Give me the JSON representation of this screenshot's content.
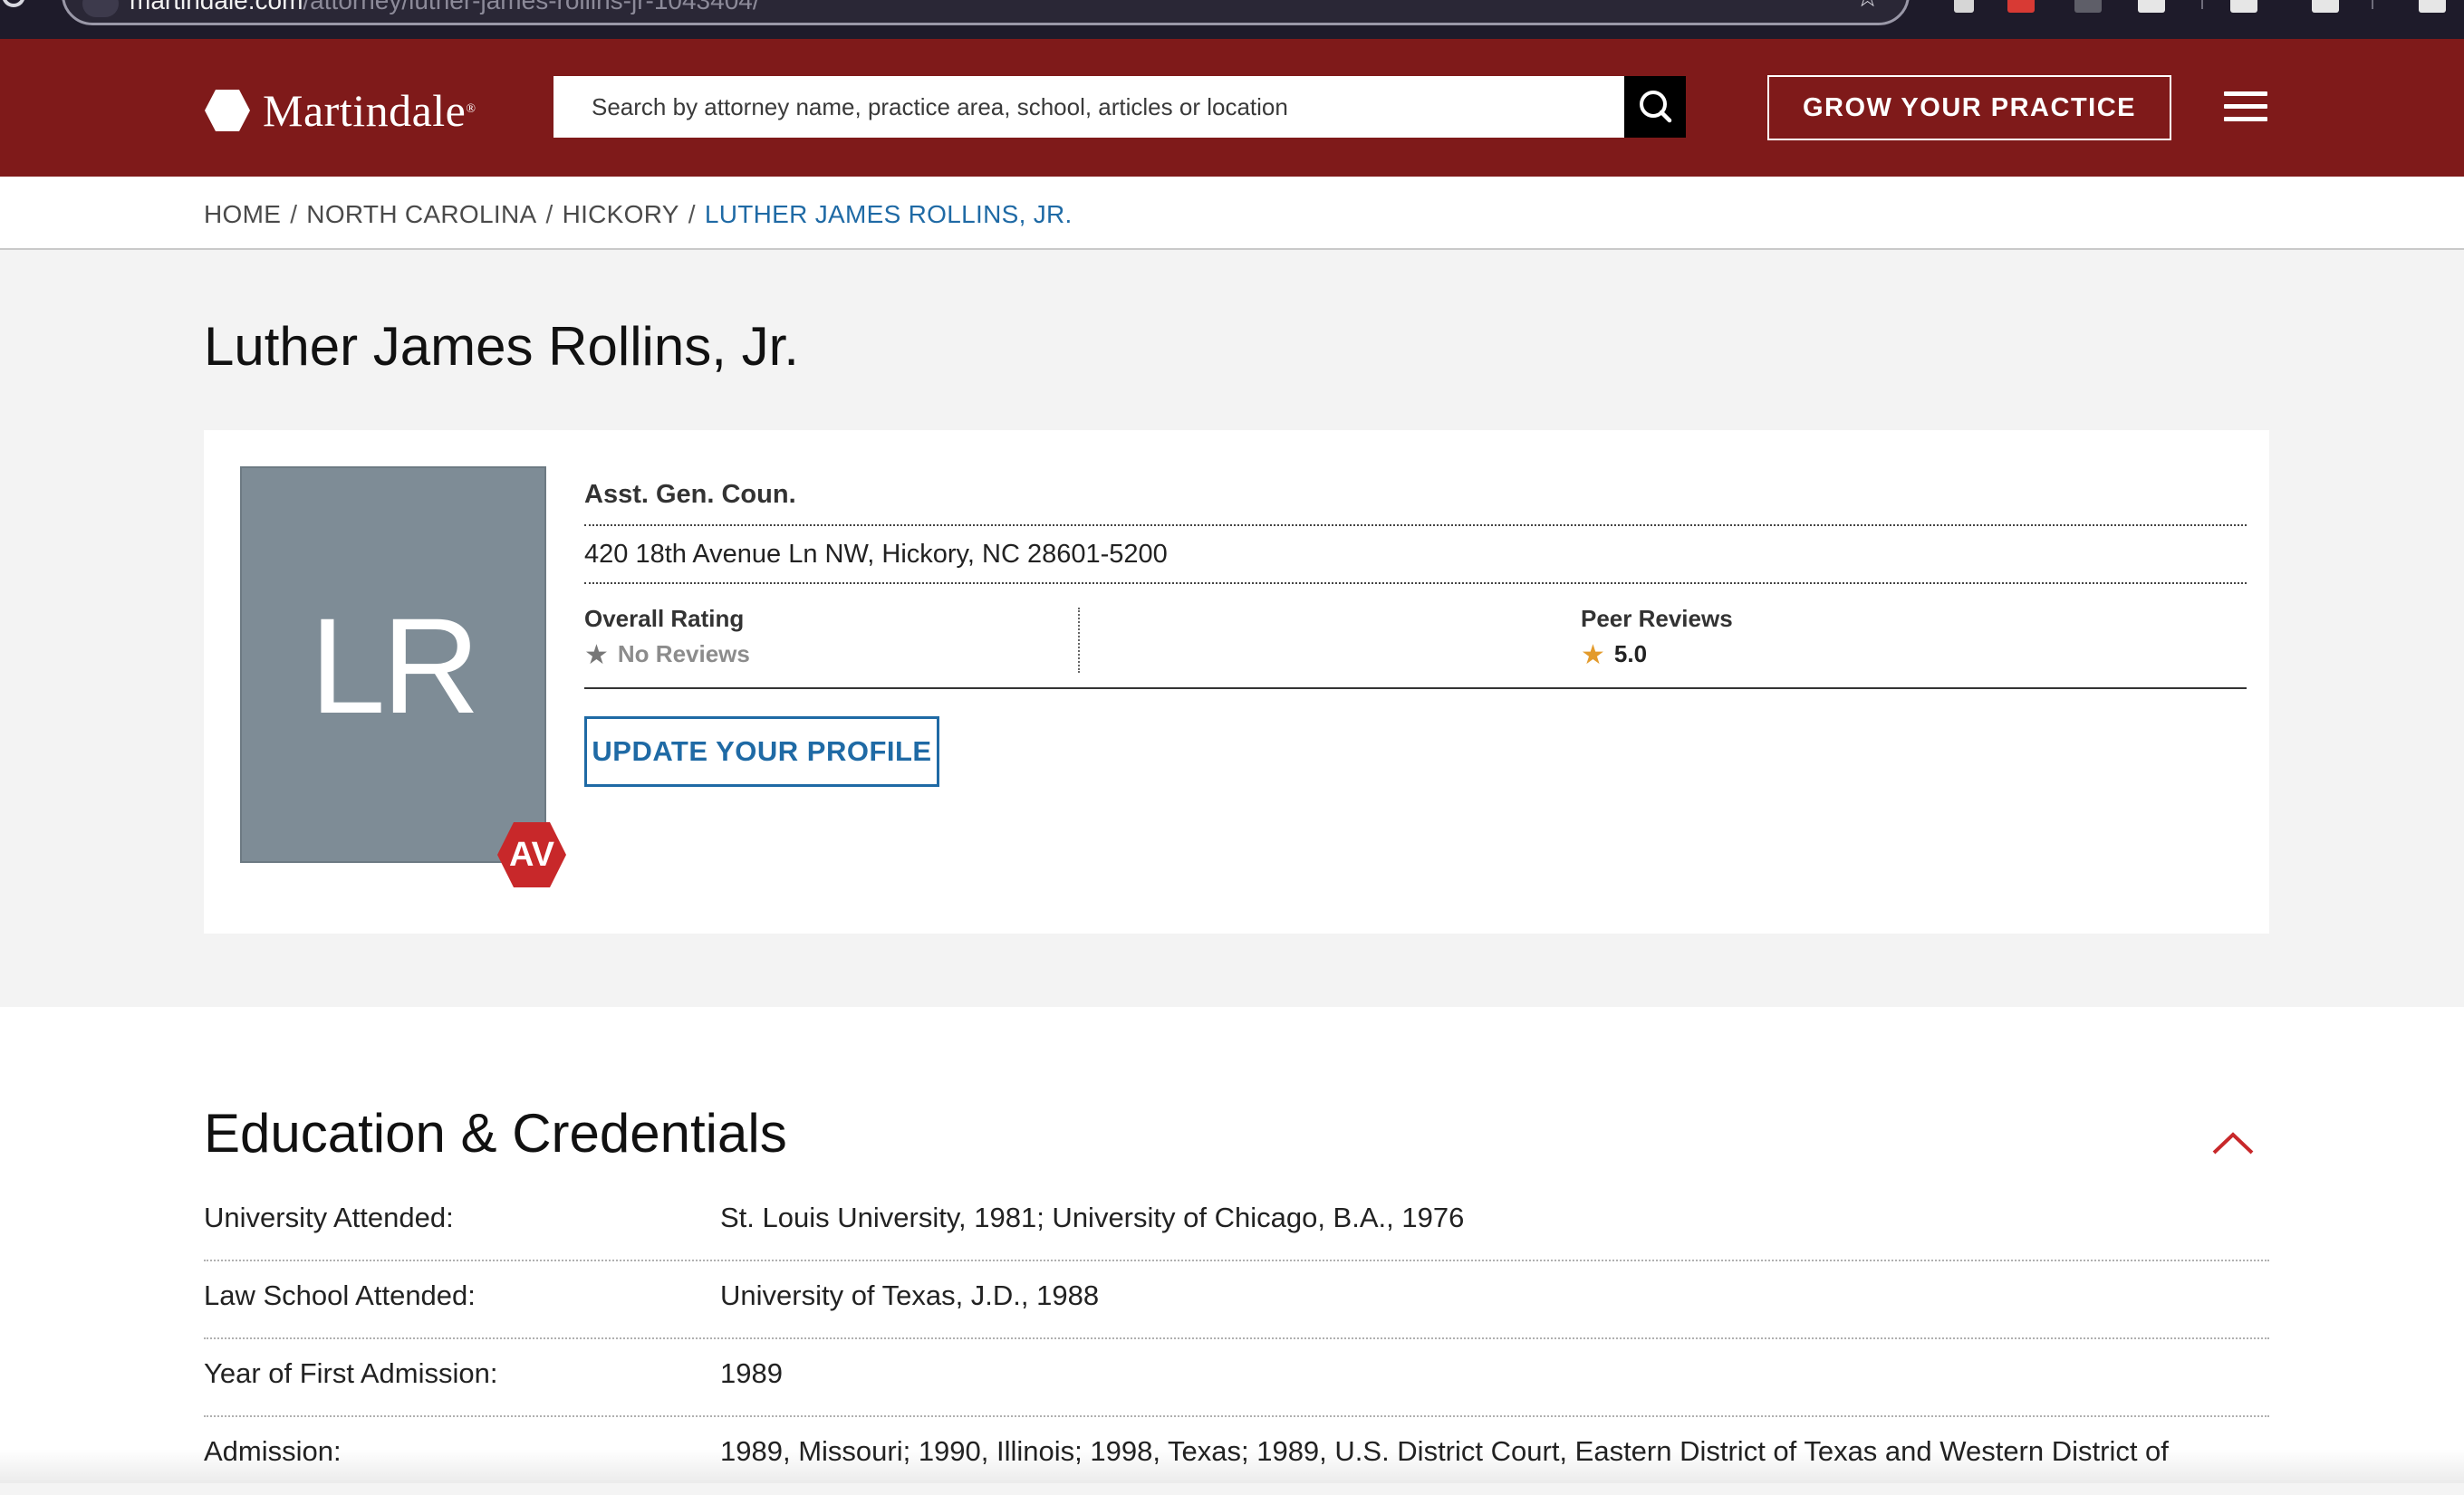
{
  "browser": {
    "url_host": "martindale.com",
    "url_path": "/attorney/luther-james-rollins-jr-1043404/",
    "icons": [
      "reload-icon",
      "site-settings-icon",
      "bookmark-star-icon",
      "extension-icon",
      "profile-icon",
      "downloads-icon"
    ]
  },
  "header": {
    "logo_text": "Martindale",
    "logo_mark": "®",
    "search_placeholder": "Search by attorney name, practice area, school, articles or location",
    "grow_label": "GROW YOUR PRACTICE",
    "colors": {
      "brand": "#7f1a1a",
      "link": "#1f6aa5",
      "badge": "#c8282a",
      "star": "#e39b2c"
    }
  },
  "breadcrumb": {
    "items": [
      "HOME",
      "NORTH CAROLINA",
      "HICKORY"
    ],
    "current": "LUTHER JAMES ROLLINS, JR.",
    "separator": "/"
  },
  "profile": {
    "name": "Luther James Rollins, Jr.",
    "initials": "LR",
    "badge": "AV",
    "title": "Asst. Gen. Coun.",
    "address": "420 18th Avenue Ln NW, Hickory, NC 28601-5200",
    "overall_rating_label": "Overall Rating",
    "overall_rating_value": "No Reviews",
    "peer_reviews_label": "Peer Reviews",
    "peer_reviews_value": "5.0",
    "update_label": "UPDATE YOUR PROFILE"
  },
  "education": {
    "title": "Education & Credentials",
    "rows": [
      {
        "label": "University Attended:",
        "value": "St. Louis University, 1981; University of Chicago, B.A., 1976"
      },
      {
        "label": "Law School Attended:",
        "value": "University of Texas, J.D., 1988"
      },
      {
        "label": "Year of First Admission:",
        "value": "1989"
      },
      {
        "label": "Admission:",
        "value": "1989, Missouri; 1990, Illinois; 1998, Texas; 1989, U.S. District Court, Eastern District of Texas and Western District of"
      }
    ]
  }
}
